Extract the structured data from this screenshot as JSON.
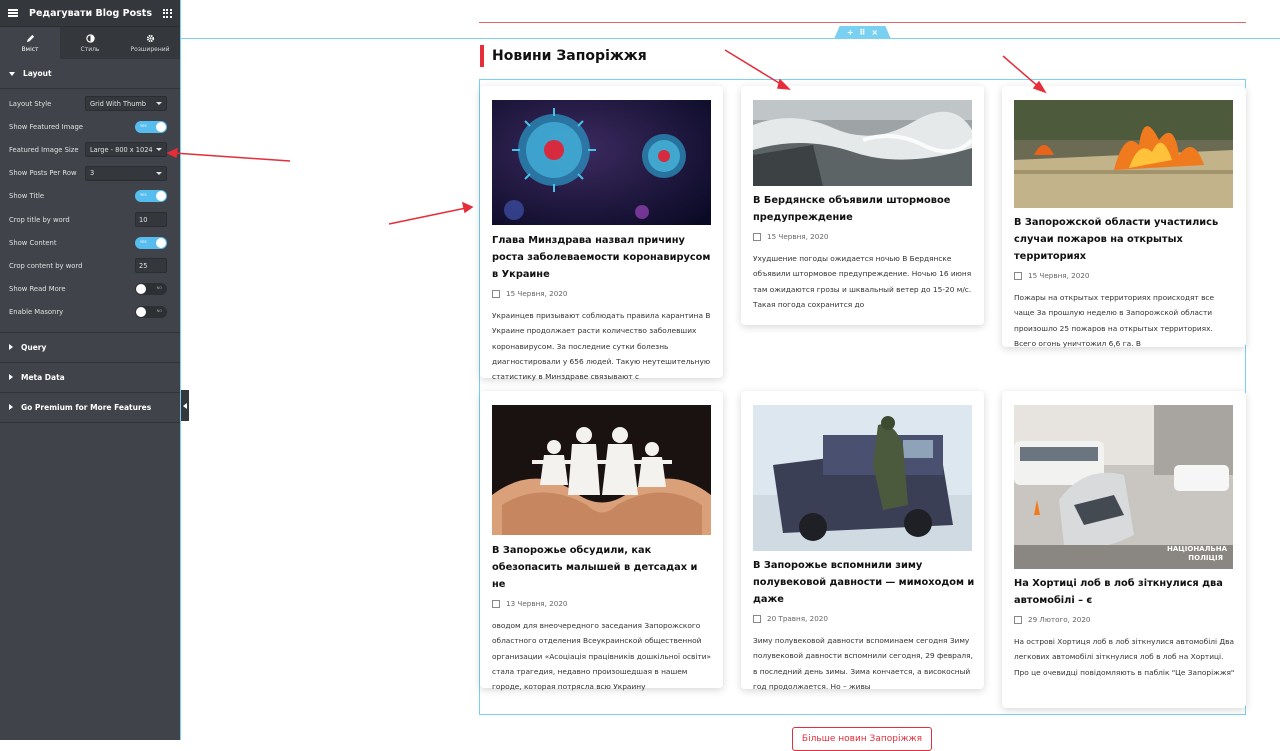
{
  "panel": {
    "title": "Редагувати Blog Posts",
    "tabs": [
      {
        "label": "Вміст",
        "icon": "pencil-icon"
      },
      {
        "label": "Стиль",
        "icon": "half-circle-icon"
      },
      {
        "label": "Розширений",
        "icon": "gear-icon"
      }
    ],
    "layout_section": "Layout",
    "controls": {
      "layout_style": {
        "label": "Layout Style",
        "value": "Grid With Thumb"
      },
      "show_featured_image": {
        "label": "Show Featured Image",
        "state": "YES"
      },
      "featured_image_size": {
        "label": "Featured Image Size",
        "value": "Large - 800 x 1024"
      },
      "posts_per_row": {
        "label": "Show Posts Per Row",
        "value": "3"
      },
      "show_title": {
        "label": "Show Title",
        "state": "YES"
      },
      "crop_title": {
        "label": "Crop title by word",
        "value": "10"
      },
      "show_content": {
        "label": "Show Content",
        "state": "YES"
      },
      "crop_content": {
        "label": "Crop content by word",
        "value": "25"
      },
      "show_read_more": {
        "label": "Show Read More",
        "state": "NO"
      },
      "enable_masonry": {
        "label": "Enable Masonry",
        "state": "NO"
      }
    },
    "sections": [
      "Query",
      "Meta Data",
      "Go Premium for More Features"
    ]
  },
  "page": {
    "heading": "Новини Запоріжжя",
    "more_button": "Більше новин Запоріжжя",
    "accent_color": "#e62d3a"
  },
  "posts": [
    {
      "title": "Глава Минздрава назвал причину роста заболеваемости коронавирусом в Украине",
      "date": "15 Червня, 2020",
      "excerpt": "Украинцев призывают соблюдать правила карантина В Украине продолжает расти количество заболевших коронавирусом. За последние сутки болезнь диагностировали у 656 людей. Такую неутешительную статистику в Минздраве связывают с",
      "image": "coronavirus-image"
    },
    {
      "title": "В Бердянске объявили штормовое предупреждение",
      "date": "15 Червня, 2020",
      "excerpt": "Ухудшение погоды ожидается ночью В Бердянске объявили штормовое предупреждение. Ночью 16 июня там ожидаются грозы и шквальный ветер до 15-20 м/с. Такая погода сохранится до",
      "image": "storm-sea-image"
    },
    {
      "title": "В Запорожской области участились случаи пожаров на открытых территориях",
      "date": "15 Червня, 2020",
      "excerpt": "Пожары на открытых территориях происходят все чаще За прошлую неделю в Запорожской области произошло 25 пожаров на открытых территориях. Всего огонь уничтожил 6,6 га. В",
      "image": "grass-fire-image"
    },
    {
      "title": "В Запорожье обсудили, как обезопасить малышей в детсадах и не",
      "date": "13 Червня, 2020",
      "excerpt": "оводом для внеочередного заседания Запорожского областного отделения Всеукраинской общественной организации «Асоціація працівників дошкільної освіти» стала трагедия, недавно произошедшая в нашем городе, которая потрясла всю Украину",
      "image": "paper-family-hands-image"
    },
    {
      "title": "В Запорожье вспомнили зиму полувековой давности — мимоходом и даже",
      "date": "20 Травня, 2020",
      "excerpt": "Зиму полувековой давности вспоминаем сегодня Зиму полувековой давности вспомнили сегодня, 29 февраля, в последний день зимы. Зима кончается, а високосный год продолжается. Но – живы",
      "image": "military-vehicle-snow-image"
    },
    {
      "title": "На Хортиці лоб в лоб зіткнулися два автомобілі – є",
      "date": "29 Лютого, 2020",
      "excerpt": "На острові Хортиця лоб в лоб зіткнулися автомобілі Два легкових автомобілі зіткнулися лоб в лоб на Хортиці. Про це очевидці повідомляють в паблік \"Це Запоріжжя\"",
      "image": "car-crash-image",
      "watermark": "НАЦІОНАЛЬНА ПОЛІЦІЯ"
    }
  ]
}
